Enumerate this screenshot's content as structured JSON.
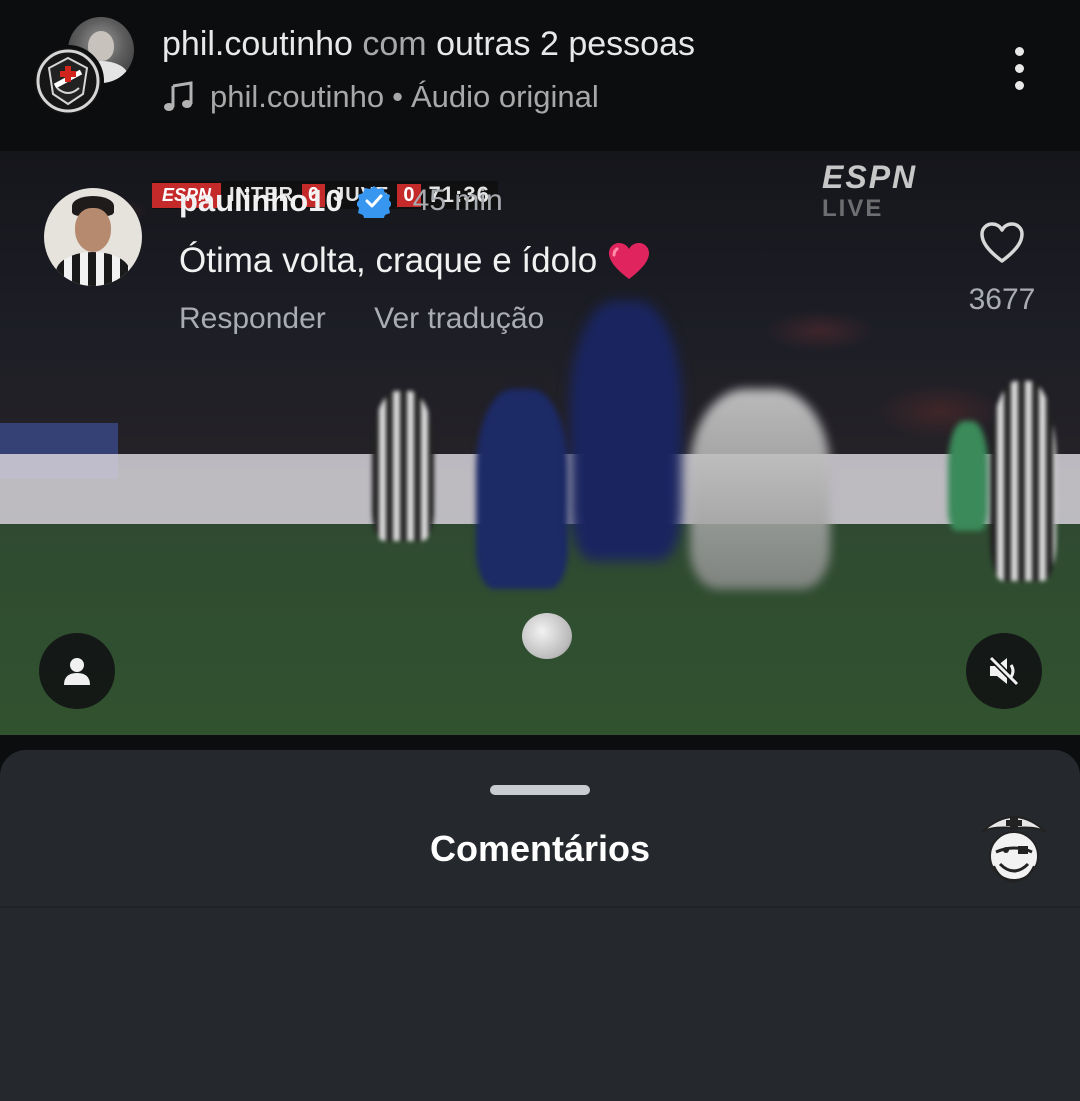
{
  "header": {
    "author": "phil.coutinho",
    "with_text": "com",
    "others": "outras 2 pessoas",
    "audio_owner": "phil.coutinho",
    "audio_separator": "•",
    "audio_label": "Áudio original",
    "icons": [
      "avatar-photo",
      "vasco-crest-avatar",
      "music-note-icon",
      "more-vertical-icon"
    ]
  },
  "video": {
    "score_logo": "ESPN",
    "team_home": "INTER",
    "score_home": "0",
    "team_away": "JUVE",
    "score_away": "0",
    "clock": "71:36",
    "watermark": "ESPN",
    "watermark_sub": "LIVE",
    "icons": [
      "person-icon",
      "muted-speaker-icon"
    ]
  },
  "comments": {
    "title": "Comentários",
    "items": [
      {
        "username": "paulinho10",
        "verified": true,
        "time": "45 min",
        "text": "Ótima volta, craque e ídolo",
        "emoji": "red-heart",
        "reply_label": "Responder",
        "translate_label": "Ver tradução",
        "likes": "3677"
      }
    ]
  },
  "colors": {
    "background": "#0c0d0f",
    "sheet": "#25292e",
    "verified": "#3797f0",
    "heart": "#e0245e"
  }
}
